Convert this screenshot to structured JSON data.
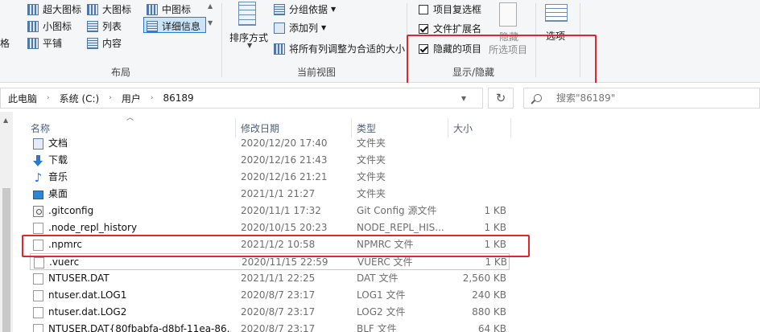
{
  "ribbon": {
    "layout_group": {
      "label": "布局",
      "row1": [
        "超大图标",
        "大图标",
        "中图标"
      ],
      "row2": [
        "小图标",
        "列表",
        "详细信息"
      ],
      "row3": [
        "平铺",
        "内容"
      ],
      "partial_left": "格"
    },
    "current_view_group": {
      "label": "当前视图",
      "sort_by": "排序方式",
      "group_by": "分组依据",
      "add_columns": "添加列",
      "fit_columns": "将所有列调整为合适的大小"
    },
    "show_hide_group": {
      "label": "显示/隐藏",
      "item_checkboxes": {
        "label": "项目复选框",
        "checked": false
      },
      "file_extensions": {
        "label": "文件扩展名",
        "checked": true
      },
      "hidden_items": {
        "label": "隐藏的项目",
        "checked": true
      },
      "hide_selected_line1": "隐藏",
      "hide_selected_line2": "所选项目"
    },
    "options": {
      "label": "选项"
    }
  },
  "address": {
    "crumbs": [
      "此电脑",
      "系统 (C:)",
      "用户",
      "86189"
    ],
    "search_placeholder": "搜索\"86189\""
  },
  "columns": {
    "name": "名称",
    "date": "修改日期",
    "type": "类型",
    "size": "大小"
  },
  "files": [
    {
      "name": "文档",
      "date": "2020/12/20 17:40",
      "type": "文件夹",
      "size": "",
      "icon": "docs-folder-icon"
    },
    {
      "name": "下载",
      "date": "2020/12/16 21:43",
      "type": "文件夹",
      "size": "",
      "icon": "download-icon"
    },
    {
      "name": "音乐",
      "date": "2020/12/16 21:21",
      "type": "文件夹",
      "size": "",
      "icon": "music-icon"
    },
    {
      "name": "桌面",
      "date": "2021/1/1 21:27",
      "type": "文件夹",
      "size": "",
      "icon": "desktop-icon"
    },
    {
      "name": ".gitconfig",
      "date": "2020/11/1 17:32",
      "type": "Git Config 源文件",
      "size": "1 KB",
      "icon": "config-file-icon"
    },
    {
      "name": ".node_repl_history",
      "date": "2020/10/15 20:23",
      "type": "NODE_REPL_HIS...",
      "size": "1 KB",
      "icon": "file-icon"
    },
    {
      "name": ".npmrc",
      "date": "2021/1/2 10:58",
      "type": "NPMRC 文件",
      "size": "1 KB",
      "icon": "file-icon"
    },
    {
      "name": ".vuerc",
      "date": "2020/11/15 22:59",
      "type": "VUERC 文件",
      "size": "1 KB",
      "icon": "file-icon"
    },
    {
      "name": "NTUSER.DAT",
      "date": "2021/1/1 22:25",
      "type": "DAT 文件",
      "size": "2,560 KB",
      "icon": "file-icon"
    },
    {
      "name": "ntuser.dat.LOG1",
      "date": "2020/8/7 23:17",
      "type": "LOG1 文件",
      "size": "240 KB",
      "icon": "file-icon"
    },
    {
      "name": "ntuser.dat.LOG2",
      "date": "2020/8/7 23:17",
      "type": "LOG2 文件",
      "size": "880 KB",
      "icon": "file-icon"
    },
    {
      "name": "NTUSER.DAT{80fbabfa-d8bf-11ea-86...",
      "date": "2020/8/7 23:17",
      "type": "BLF 文件",
      "size": "64 KB",
      "icon": "file-icon"
    }
  ],
  "colors": {
    "highlight_red": "#e0262b",
    "selection_blue": "#cce4f7",
    "header_text": "#4c607a"
  }
}
